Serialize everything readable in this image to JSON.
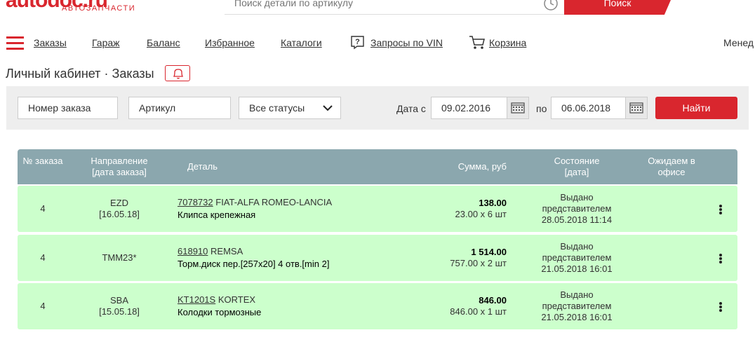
{
  "header": {
    "logo_text": "autodoc.ru",
    "logo_sub": "АВТОЗАПЧАСТИ",
    "search_placeholder": "Поиск детали по артикулу",
    "search_button": "Поиск"
  },
  "nav": {
    "items": [
      "Заказы",
      "Гараж",
      "Баланс",
      "Избранное",
      "Каталоги",
      "Запросы по VIN",
      "Корзина"
    ],
    "manager": "Менед"
  },
  "breadcrumb": {
    "root": "Личный кабинет",
    "separator": "·",
    "current": "Заказы"
  },
  "filters": {
    "order_number_placeholder": "Номер заказа",
    "article_placeholder": "Артикул",
    "status_selected": "Все статусы",
    "date_from_label": "Дата с",
    "date_from": "09.02.2016",
    "date_to_label": "по",
    "date_to": "06.06.2018",
    "find_button": "Найти"
  },
  "table": {
    "headers": {
      "number": "№ заказа",
      "direction": "Направление",
      "direction_sub": "[дата заказа]",
      "detail": "Деталь",
      "sum": "Сумма, руб",
      "state": "Состояние",
      "state_sub": "[дата]",
      "office": "Ожидаем в офисе"
    },
    "rows": [
      {
        "number": "4",
        "direction": "EZD",
        "order_date": "[16.05.18]",
        "article": "7078732",
        "brand": "FIAT-ALFA ROMEO-LANCIA",
        "name": "Клипса крепежная",
        "sum": "138.00",
        "sum_detail": "23.00 x 6 шт",
        "status": "Выдано",
        "status_line2": "представителем",
        "status_date": "28.05.2018 11:14"
      },
      {
        "number": "4",
        "direction": "TMM23*",
        "order_date": "",
        "article": "618910",
        "brand": "REMSA",
        "name": "Торм.диск пер.[257x20] 4 отв.[min 2]",
        "sum": "1 514.00",
        "sum_detail": "757.00 x 2 шт",
        "status": "Выдано",
        "status_line2": "представителем",
        "status_date": "21.05.2018 16:01"
      },
      {
        "number": "4",
        "direction": "SBA",
        "order_date": "[15.05.18]",
        "article": "KT1201S",
        "brand": "KORTEX",
        "name": "Колодки тормозные",
        "sum": "846.00",
        "sum_detail": "846.00 x 1 шт",
        "status": "Выдано",
        "status_line2": "представителем",
        "status_date": "21.05.2018 16:01"
      }
    ]
  },
  "colors": {
    "brand_red": "#d9262e",
    "table_header": "#8ba7ae",
    "row_green": "#ccffcc",
    "panel_gray": "#eeeeee"
  }
}
